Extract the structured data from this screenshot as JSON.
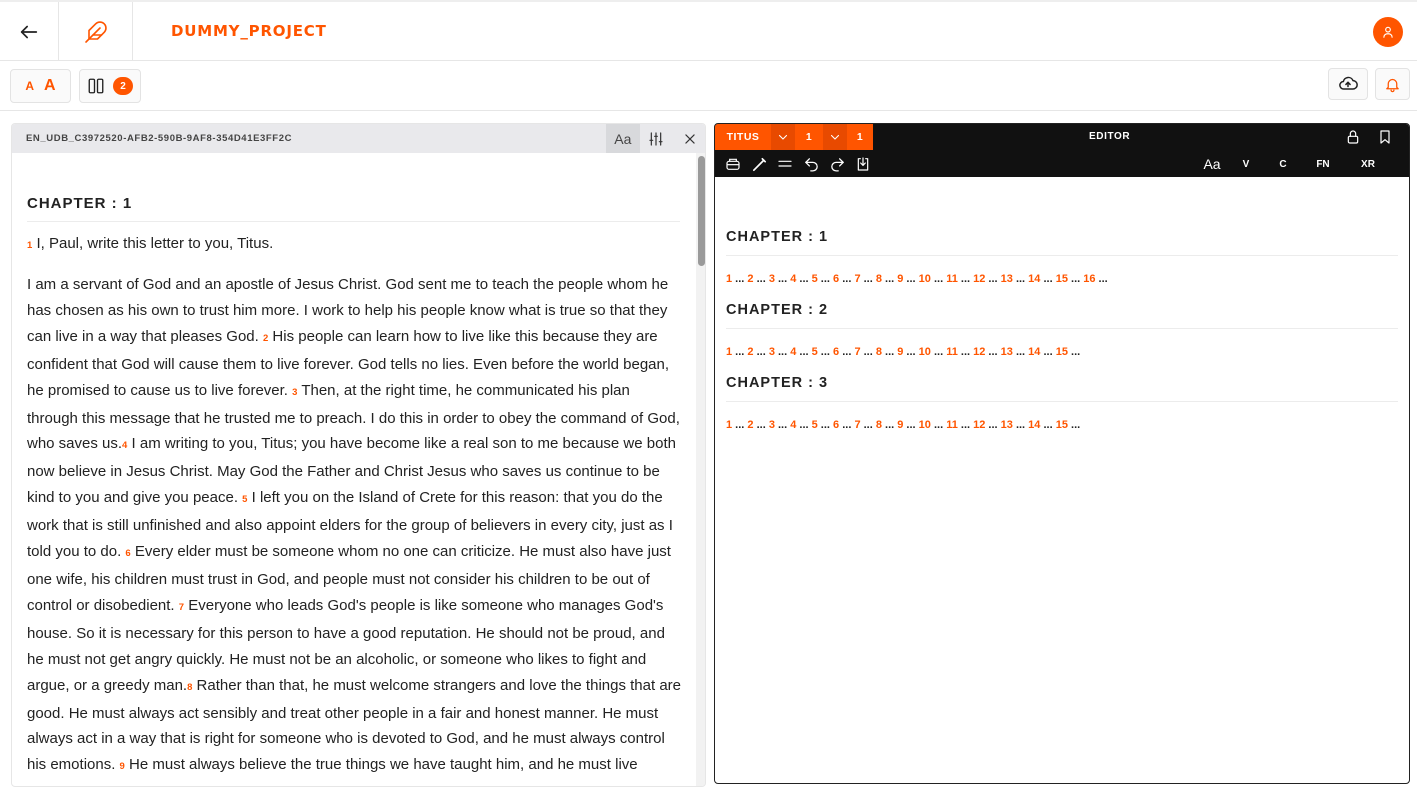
{
  "header": {
    "project_name": "DUMMY_PROJECT",
    "accent_color": "#ff5500"
  },
  "toolbar": {
    "font_small": "A",
    "font_large": "A",
    "pane_count": "2"
  },
  "resource_pane": {
    "file_name": "EN_UDB_C3972520-AFB2-590B-9AF8-354D41E3FF2C",
    "font_tool_label": "Aa",
    "chapter_heading": "CHAPTER : 1",
    "verse1_num": "1",
    "verse1_text": "I, Paul, write this letter to you, Titus.",
    "paragraph": [
      {
        "t": "I am a servant of God and an apostle of Jesus Christ. God sent me to teach the people whom he has chosen as his own to trust him more. I work to help his people know what is true so that they can live in a way that pleases God. "
      },
      {
        "v": "2"
      },
      {
        "t": " His people can learn how to live like this because they are confident that God will cause them to live forever. God tells no lies. Even before the world began, he promised to cause us to live forever. "
      },
      {
        "v": "3"
      },
      {
        "t": " Then, at the right time, he communicated his plan through this message that he trusted me to preach. I do this in order to obey the command of God, who saves us."
      },
      {
        "v": "4"
      },
      {
        "t": " I am writing to you, Titus; you have become like a real son to me because we both now believe in Jesus Christ. May God the Father and Christ Jesus who saves us continue to be kind to you and give you peace. "
      },
      {
        "v": "5"
      },
      {
        "t": " I left you on the Island of Crete for this reason: that you do the work that is still unfinished and also appoint elders for the group of believers in every city, just as I told you to do. "
      },
      {
        "v": "6"
      },
      {
        "t": " Every elder must be someone whom no one can criticize. He must also have just one wife, his children must trust in God, and people must not consider his children to be out of control or disobedient. "
      },
      {
        "v": "7"
      },
      {
        "t": " Everyone who leads God's people is like someone who manages God's house. So it is necessary for this person to have a good reputation. He should not be proud, and he must not get angry quickly. He must not be an alcoholic, or someone who likes to fight and argue, or a greedy man."
      },
      {
        "v": "8"
      },
      {
        "t": " Rather than that, he must welcome strangers and love the things that are good. He must always act sensibly and treat other people in a fair and honest manner. He must always act in a way that is right for someone who is devoted to God, and he must always control his emotions. "
      },
      {
        "v": "9"
      },
      {
        "t": " He must always believe the true things we have taught him, and he must live according to them. He must do this in order to persuade people to also live like this and to correct people if they do not"
      }
    ]
  },
  "editor_pane": {
    "book": "TITUS",
    "chapter": "1",
    "verse": "1",
    "title": "EDITOR",
    "font_tool_label": "Aa",
    "markers": [
      "V",
      "C",
      "FN",
      "XR"
    ],
    "chapters": [
      {
        "heading": "CHAPTER : 1",
        "verses": [
          "1",
          "2",
          "3",
          "4",
          "5",
          "6",
          "7",
          "8",
          "9",
          "10",
          "11",
          "12",
          "13",
          "14",
          "15",
          "16"
        ]
      },
      {
        "heading": "CHAPTER : 2",
        "verses": [
          "1",
          "2",
          "3",
          "4",
          "5",
          "6",
          "7",
          "8",
          "9",
          "10",
          "11",
          "12",
          "13",
          "14",
          "15"
        ]
      },
      {
        "heading": "CHAPTER : 3",
        "verses": [
          "1",
          "2",
          "3",
          "4",
          "5",
          "6",
          "7",
          "8",
          "9",
          "10",
          "11",
          "12",
          "13",
          "14",
          "15"
        ]
      }
    ],
    "ellipsis": "..."
  }
}
